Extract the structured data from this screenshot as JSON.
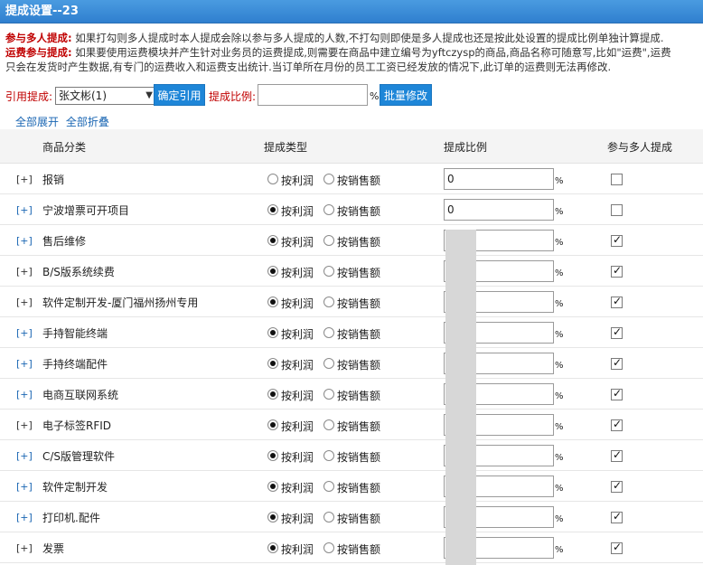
{
  "title": "提成设置--23",
  "notes": {
    "multi_label": "参与多人提成:",
    "multi_text": "如果打勾则多人提成时本人提成会除以参与多人提成的人数,不打勾则即使是多人提成也还是按此处设置的提成比例单独计算提成.",
    "freight_label": "运费参与提成:",
    "freight_text": "如果要使用运费模块并产生针对业务员的运费提成,则需要在商品中建立编号为yftczysp的商品,商品名称可随意写,比如\"运费\",运费",
    "freight_text2": "只会在发货时产生数据,有专门的运费收入和运费支出统计.当订单所在月份的员工工资已经发放的情况下,此订单的运费则无法再修改."
  },
  "toolbar": {
    "ref_label": "引用提成:",
    "ref_selected": "张文彬(1)",
    "confirm_button": "确定引用",
    "rate_label": "提成比例:",
    "rate_value": "",
    "percent": "%",
    "batch_button": "批量修改"
  },
  "expand": {
    "expand_all": "全部展开",
    "collapse_all": "全部折叠"
  },
  "columns": {
    "category": "商品分类",
    "type": "提成类型",
    "rate": "提成比例",
    "multi": "参与多人提成"
  },
  "radio_labels": {
    "profit": "按利润",
    "sales": "按销售额"
  },
  "percent_sign": "%",
  "rows": [
    {
      "toggle": "[+]",
      "name": "报销",
      "type": "none",
      "rate": "0",
      "multi": false
    },
    {
      "toggle": "[+]",
      "name": "宁波增票可开项目",
      "type": "profit",
      "rate": "0",
      "multi": false
    },
    {
      "toggle": "[+]",
      "name": "售后维修",
      "type": "profit",
      "rate": "",
      "multi": true
    },
    {
      "toggle": "[+]",
      "name": "B/S版系统续费",
      "type": "profit",
      "rate": "",
      "multi": true
    },
    {
      "toggle": "[+]",
      "name": "软件定制开发-厦门福州扬州专用",
      "type": "profit",
      "rate": "",
      "multi": true
    },
    {
      "toggle": "[+]",
      "name": "手持智能终端",
      "type": "profit",
      "rate": "",
      "multi": true
    },
    {
      "toggle": "[+]",
      "name": "手持终端配件",
      "type": "profit",
      "rate": "",
      "multi": true
    },
    {
      "toggle": "[+]",
      "name": "电商互联网系统",
      "type": "profit",
      "rate": "",
      "multi": true
    },
    {
      "toggle": "[+]",
      "name": "电子标签RFID",
      "type": "profit",
      "rate": "",
      "multi": true
    },
    {
      "toggle": "[+]",
      "name": "C/S版管理软件",
      "type": "profit",
      "rate": "",
      "multi": true
    },
    {
      "toggle": "[+]",
      "name": "软件定制开发",
      "type": "profit",
      "rate": "",
      "multi": true
    },
    {
      "toggle": "[+]",
      "name": "打印机.配件",
      "type": "profit",
      "rate": "",
      "multi": true
    },
    {
      "toggle": "[+]",
      "name": "发票",
      "type": "profit",
      "rate": "",
      "multi": true
    }
  ]
}
